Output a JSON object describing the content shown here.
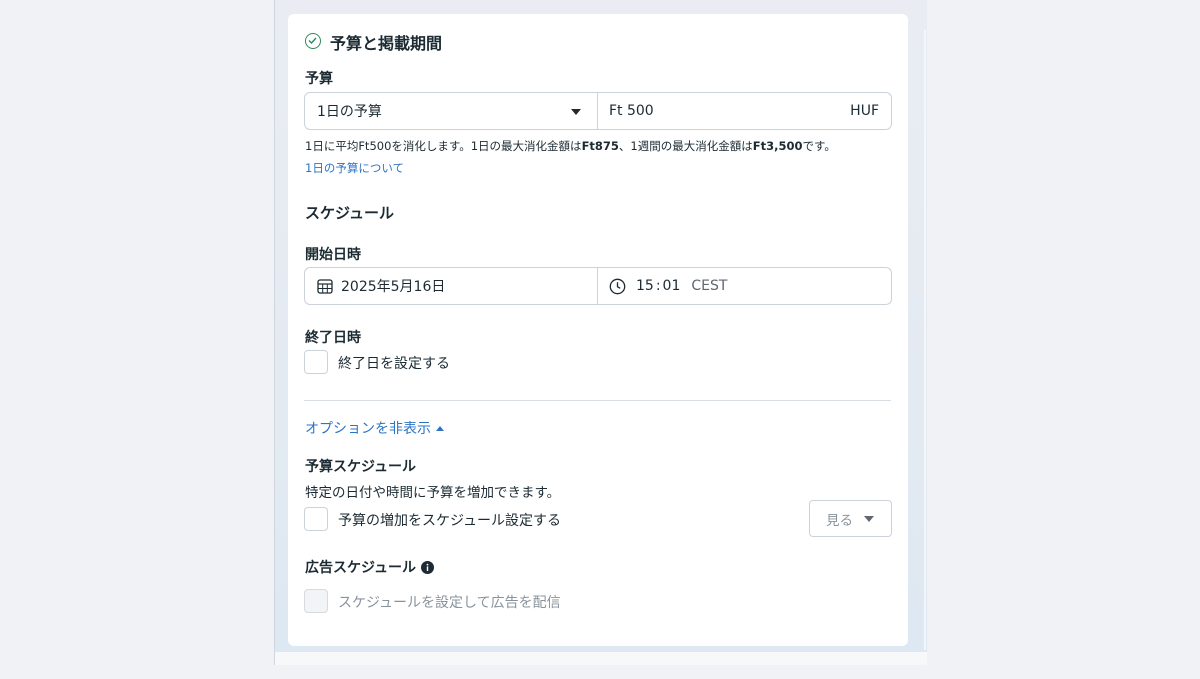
{
  "section": {
    "title": "予算と掲載期間",
    "status_icon": "check-circle-icon"
  },
  "budget": {
    "label": "予算",
    "type_value": "1日の予算",
    "amount_value": "Ft 500",
    "currency": "HUF",
    "description_part1": "1日に平均Ft500を消化します。1日の最大消化金額は",
    "description_bold1": "Ft875",
    "description_part2": "、1週間の最大消化金額は",
    "description_bold2": "Ft3,500",
    "description_part3": "です。",
    "learn_more_link": "1日の予算について"
  },
  "schedule": {
    "heading": "スケジュール",
    "start_label": "開始日時",
    "start_date": "2025年5月16日",
    "start_hour": "15",
    "start_minute": "01",
    "timezone": "CEST",
    "end_label": "終了日時",
    "end_checkbox_label": "終了日を設定する"
  },
  "options": {
    "toggle_label": "オプションを非表示",
    "budget_schedule_heading": "予算スケジュール",
    "budget_schedule_desc": "特定の日付や時間に予算を増加できます。",
    "budget_schedule_checkbox": "予算の増加をスケジュール設定する",
    "view_button": "見る",
    "ad_schedule_heading": "広告スケジュール",
    "ad_schedule_checkbox": "スケジュールを設定して広告を配信"
  },
  "colors": {
    "accent_link": "#2d74c4",
    "check_green": "#2e8b57",
    "text_primary": "#1c2b33",
    "border": "#cbd2d9"
  }
}
